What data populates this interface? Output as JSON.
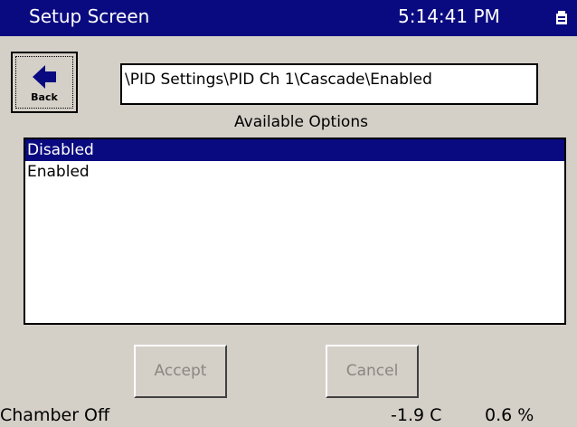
{
  "titlebar": {
    "title": "Setup Screen",
    "clock": "5:14:41 PM",
    "tray_icon": "tray-status-icon",
    "color": "#0a0a80"
  },
  "back_button": {
    "label": "Back",
    "icon": "arrow-left-icon"
  },
  "path": {
    "value": "\\PID Settings\\PID Ch 1\\Cascade\\Enabled"
  },
  "options": {
    "heading": "Available Options",
    "items": [
      {
        "label": "Disabled",
        "selected": true
      },
      {
        "label": "Enabled",
        "selected": false
      }
    ],
    "selection_color": "#0a0a80"
  },
  "actions": {
    "accept_label": "Accept",
    "cancel_label": "Cancel",
    "enabled": false
  },
  "status_bar": {
    "chamber": "Chamber Off",
    "temperature": "-1.9 C",
    "percent": "0.6 %"
  }
}
